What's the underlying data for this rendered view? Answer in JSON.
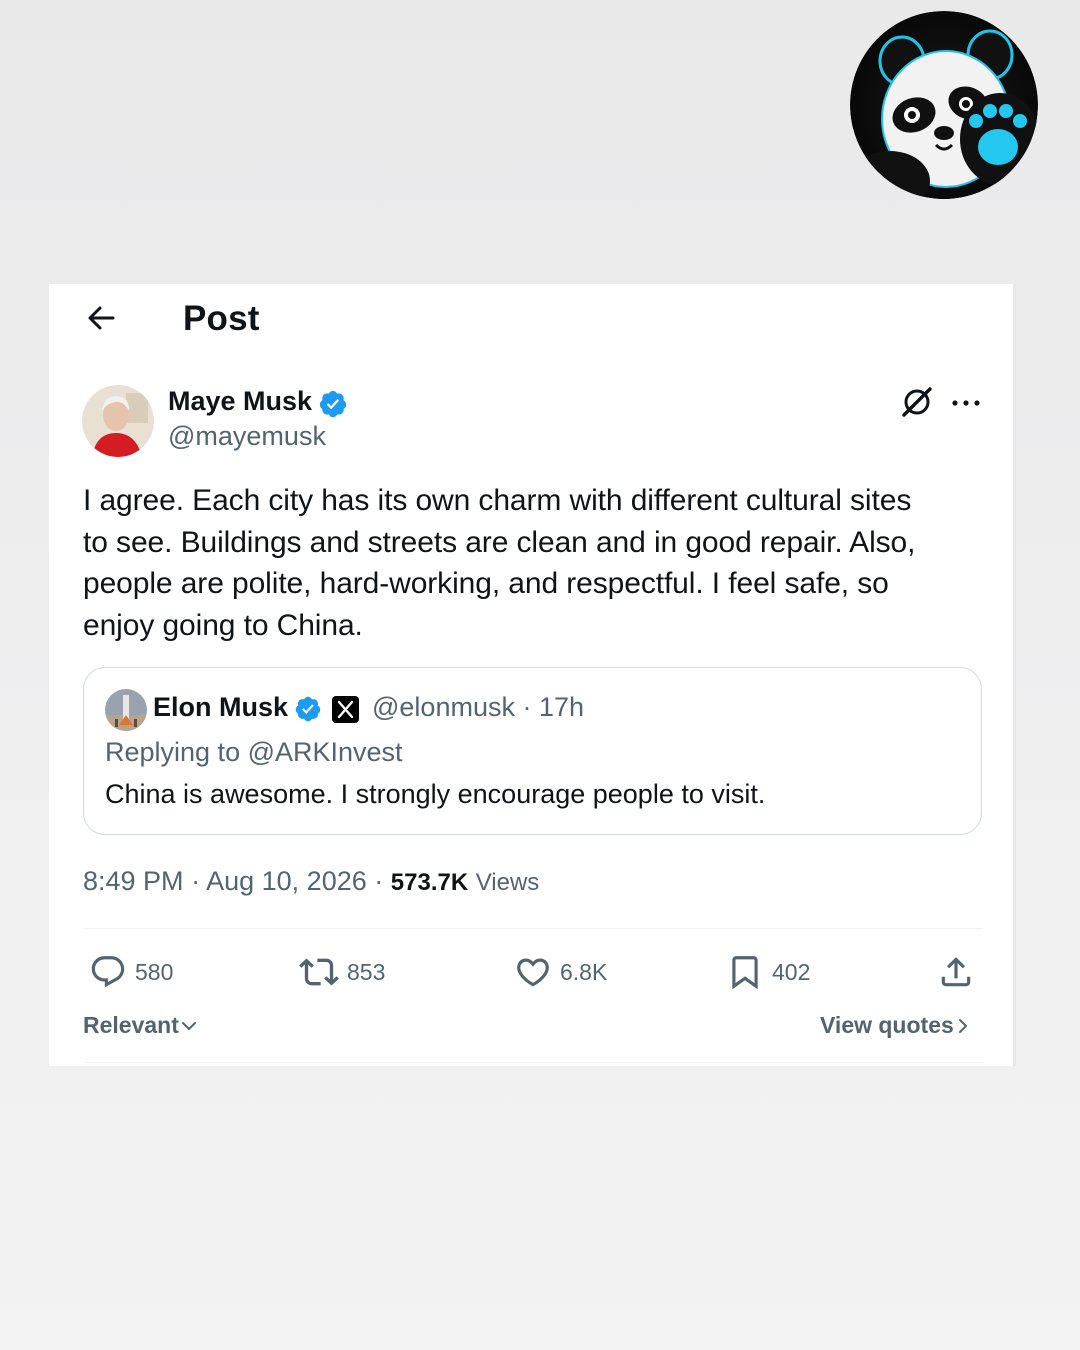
{
  "header": {
    "title": "Post"
  },
  "author": {
    "name": "Maye Musk",
    "handle": "@mayemusk"
  },
  "tweet": {
    "lines": [
      "I agree. Each city has its own charm with different cultural sites",
      "to see. Buildings and streets are clean and in good repair. Also,",
      "people are polite, hard-working, and respectful. I feel safe, so",
      "enjoy going to China."
    ]
  },
  "quote": {
    "name": "Elon Musk",
    "handle": "@elonmusk",
    "time": "17h",
    "reply_prefix": "Replying to ",
    "reply_to": "@ARKInvest",
    "text": "China is awesome. I strongly encourage people to visit."
  },
  "meta": {
    "time": "8:49 PM",
    "date": "Aug 10, 2026",
    "views": "573.7K",
    "views_label": "Views"
  },
  "actions": {
    "replies": "580",
    "reposts": "853",
    "likes": "6.8K",
    "bookmarks": "402"
  },
  "footer": {
    "sort_label": "Relevant",
    "view_quotes": "View quotes"
  },
  "colors": {
    "verified": "#1d9bf0",
    "text": "#0f1419",
    "secondary": "#536471",
    "border": "#cfd9de"
  },
  "icons": [
    "back-arrow-icon",
    "verified-badge-icon",
    "grok-icon",
    "more-icon",
    "x-logo-icon",
    "reply-icon",
    "repost-icon",
    "like-icon",
    "bookmark-icon",
    "share-icon",
    "chevron-down-icon",
    "chevron-right-icon"
  ]
}
